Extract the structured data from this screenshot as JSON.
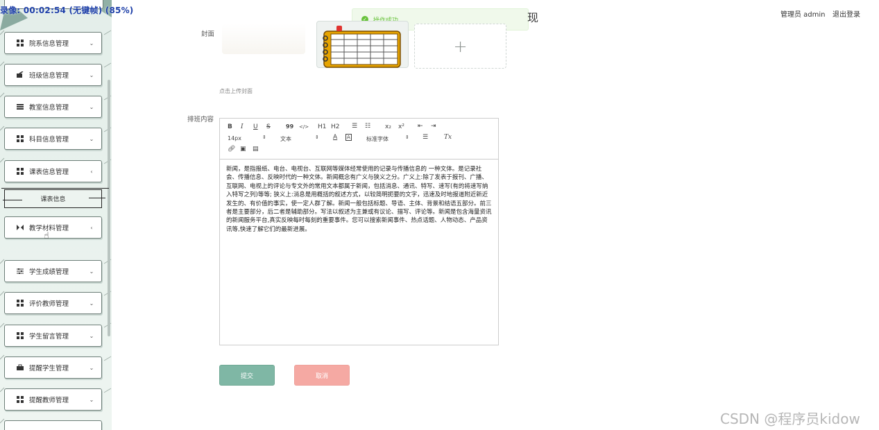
{
  "recorder": {
    "text": "录像: 00:02:54 (无键帧) (85%)"
  },
  "sidebar": {
    "items": [
      {
        "label": "院系信息管理",
        "icon": "grid-icon"
      },
      {
        "label": "班级信息管理",
        "icon": "chalkboard-icon"
      },
      {
        "label": "教室信息管理",
        "icon": "list-icon"
      },
      {
        "label": "科目信息管理",
        "icon": "grid-icon"
      },
      {
        "label": "课表信息管理",
        "icon": "grid-icon"
      },
      {
        "label": "教学材料管理",
        "icon": "material-icon"
      },
      {
        "label": "学生成绩管理",
        "icon": "sliders-icon"
      },
      {
        "label": "评价教师管理",
        "icon": "grid-icon"
      },
      {
        "label": "学生留言管理",
        "icon": "grid-icon"
      },
      {
        "label": "提醒学生管理",
        "icon": "briefcase-icon"
      },
      {
        "label": "提醒教师管理",
        "icon": "grid-icon"
      }
    ],
    "sub_item": "课表信息"
  },
  "toast": {
    "message": "操作成功",
    "status_color": "#67c23a"
  },
  "header": {
    "title_fragment": "现",
    "admin": "管理员 admin",
    "logout": "退出登录"
  },
  "form": {
    "cover_label": "封面",
    "cover_hint": "点击上传封面",
    "content_label": "排班内容",
    "upload_plus": "+",
    "editor_text": "新闻，是指报纸、电台、电视台、互联网等媒体经常使用的记录与传播信息的 一种文体。是记录社会、传播信息、反映时代的一种文体。新闻概念有广义与狭义之分。广义上:除了发表于报刊、广播、互联网、电视上的评论与专文外的常用文本都属于新闻，包括消息、通讯、特写、速写(有的将速写纳入特写之列)等等; 狭义上:消息是用概括的叙述方式，以较简明扼要的文字，迅速及时地报道附近新近发生的、有价值的事实，使一定人群了解。新闻一般包括标题、导语、主体、背景和结语五部分。前三者是主要部分，后二者是辅助部分。写法以叙述为主兼或有议论、描写、评论等。新闻是包含海量资讯的新闻服务平台,真实反映每时每刻的重要事件。您可以搜索新闻事件、热点话题、人物动态、产品资讯等,快速了解它们的最新进展。"
  },
  "toolbar": {
    "bold": "B",
    "italic": "I",
    "underline": "U",
    "strike": "S",
    "quote": "99",
    "code": "</>",
    "h1": "H1",
    "h2": "H2",
    "sub": "x₂",
    "sup": "x²",
    "font_size": "14px",
    "text_type": "文本",
    "font_family": "标准字体",
    "clear": "Tx"
  },
  "buttons": {
    "submit": "提交",
    "cancel": "取消"
  },
  "watermark": "CSDN @程序员kidow",
  "colors": {
    "accent": "#7fb7a5",
    "cancel": "#f5a9a3"
  }
}
